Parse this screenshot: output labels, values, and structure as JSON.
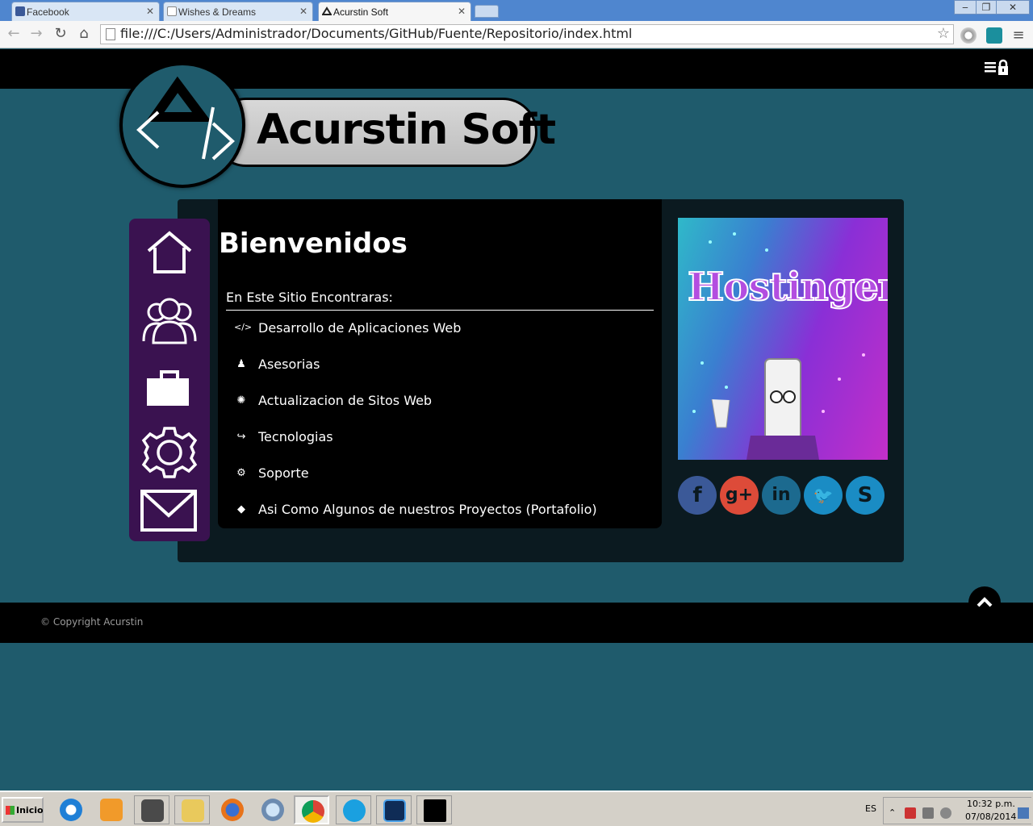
{
  "browser": {
    "tabs": [
      {
        "title": "Facebook",
        "active": false
      },
      {
        "title": "Wishes & Dreams",
        "active": false
      },
      {
        "title": "Acurstin Soft",
        "active": true
      }
    ],
    "tab_close": "✕",
    "url": "file:///C:/Users/Administrador/Documents/GitHub/Fuente/Repositorio/index.html",
    "window_buttons": [
      "‒",
      "❐",
      "✕"
    ],
    "nav": {
      "back": "←",
      "forward": "→",
      "reload": "↻",
      "home": "⌂"
    },
    "star": "☆"
  },
  "site": {
    "brand": "Acurstin Soft",
    "menu_icon": "hamburger-lock-icon",
    "heading": "Bienvenidos",
    "list_title": "En Este Sitio Encontraras:",
    "services": [
      {
        "icon": "code-icon",
        "glyph": "</>",
        "label": "Desarrollo de Aplicaciones Web"
      },
      {
        "icon": "user-icon",
        "glyph": "♟",
        "label": "Asesorias"
      },
      {
        "icon": "spinner-icon",
        "glyph": "✺",
        "label": "Actualizacion de Sitos Web"
      },
      {
        "icon": "share-icon",
        "glyph": "↪",
        "label": "Tecnologias"
      },
      {
        "icon": "gears-icon",
        "glyph": "⚙",
        "label": "Soporte"
      },
      {
        "icon": "tag-icon",
        "glyph": "◆",
        "label": "Asi Como Algunos de nuestros Proyectos (Portafolio)"
      }
    ],
    "sidebar": [
      "home-icon",
      "users-icon",
      "briefcase-icon",
      "settings-icon",
      "mail-icon"
    ],
    "ad_text": "Hostinger",
    "social": [
      {
        "name": "facebook",
        "glyph": "f",
        "color": "#3b5998"
      },
      {
        "name": "google-plus",
        "glyph": "g+",
        "color": "#dd4b39"
      },
      {
        "name": "linkedin",
        "glyph": "in",
        "color": "#1c6a8f"
      },
      {
        "name": "twitter",
        "glyph": "🐦",
        "color": "#1a8cc4"
      },
      {
        "name": "skype",
        "glyph": "S",
        "color": "#1a8cc4"
      }
    ],
    "copyright": "© Copyright Acurstin"
  },
  "taskbar": {
    "start_label": "Inicio",
    "apps": [
      "internet-explorer",
      "media-player",
      "sublime-text",
      "file-explorer",
      "firefox",
      "safari",
      "chrome",
      "skype",
      "photoshop",
      "command-prompt"
    ],
    "language": "ES",
    "time": "10:32 p.m.",
    "date": "07/08/2014"
  },
  "colors": {
    "page_bg": "#1f5b6c",
    "sidebar": "#3a1250",
    "panel": "#0b1a20"
  }
}
